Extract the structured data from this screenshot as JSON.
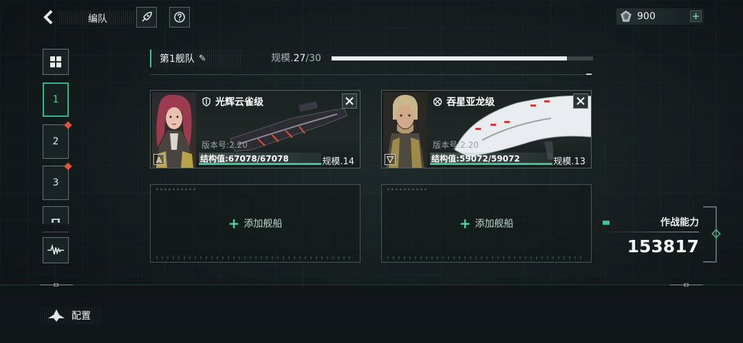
{
  "header": {
    "title": "编队",
    "currency_value": "900",
    "currency_plus": "+"
  },
  "sidebar": {
    "items": [
      {
        "label": ""
      },
      {
        "label": "1"
      },
      {
        "label": "2"
      },
      {
        "label": "3"
      }
    ]
  },
  "fleet": {
    "name": "第1舰队",
    "scale_label": "规模.",
    "scale_current": "27",
    "scale_max": "/30",
    "scale_fraction": 0.9
  },
  "ships": [
    {
      "name": "光辉云雀级",
      "version": "版本号:2.20",
      "structure": "结构值:67078/67078",
      "structure_fraction": 1.0,
      "scale": "规模.14"
    },
    {
      "name": "吞星亚龙级",
      "version": "版本号:2.20",
      "structure": "结构值:59072/59072",
      "structure_fraction": 1.0,
      "scale": "规模.13"
    }
  ],
  "empty_slots": [
    {
      "label": "添加舰船"
    },
    {
      "label": "添加舰船"
    }
  ],
  "combat_power": {
    "label": "作战能力",
    "value": "153817"
  },
  "footer": {
    "config_label": "配置"
  }
}
